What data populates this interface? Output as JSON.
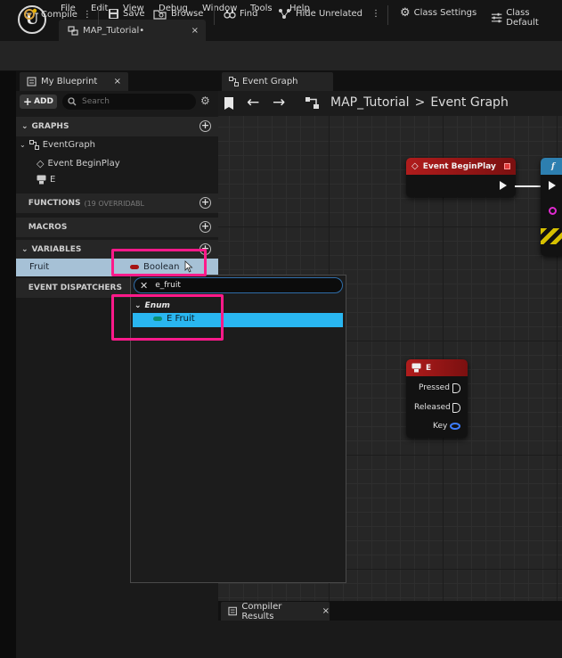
{
  "menu": [
    "File",
    "Edit",
    "View",
    "Debug",
    "Window",
    "Tools",
    "Help"
  ],
  "document_tab": {
    "title": "MAP_Tutorial•",
    "close": "×"
  },
  "toolbar": {
    "compile": "Compile",
    "save": "Save",
    "browse": "Browse",
    "find": "Find",
    "hide_unrelated": "Hide Unrelated",
    "class_settings": "Class Settings",
    "class_defaults": "Class Default"
  },
  "my_blueprint": {
    "tab_label": "My Blueprint",
    "tab_close": "×",
    "add_label": "ADD",
    "search_placeholder": "Search",
    "sections": {
      "graphs": "GRAPHS",
      "functions": "FUNCTIONS",
      "functions_sub": "(19 OVERRIDABL",
      "macros": "MACROS",
      "variables": "VARIABLES",
      "event_dispatchers": "EVENT DISPATCHERS"
    },
    "graph_items": [
      "EventGraph",
      "Event BeginPlay",
      "E"
    ],
    "variable": {
      "name": "Fruit",
      "type": "Boolean"
    }
  },
  "graph_editor": {
    "tab_label": "Event Graph",
    "breadcrumb_root": "MAP_Tutorial",
    "breadcrumb_separator": ">",
    "breadcrumb_current": "Event Graph",
    "begin_play_node": {
      "title": "Event BeginPlay"
    },
    "function_node": {
      "title": "f"
    },
    "e_node": {
      "title": "E",
      "pins": [
        "Pressed",
        "Released",
        "Key"
      ]
    }
  },
  "type_picker": {
    "search_value": "e_fruit",
    "clear": "✕",
    "category": "Enum",
    "result": "E Fruit"
  },
  "compiler_results": {
    "tab_label": "Compiler Results",
    "close": "×"
  },
  "colors": {
    "boolean_pin": "#a61414",
    "enum_pin": "#0b8f73",
    "highlight": "#ff1a8a",
    "selection": "#29b6f0",
    "event_node_header": "#b01c1c",
    "function_node_header": "#2d7fb0"
  }
}
